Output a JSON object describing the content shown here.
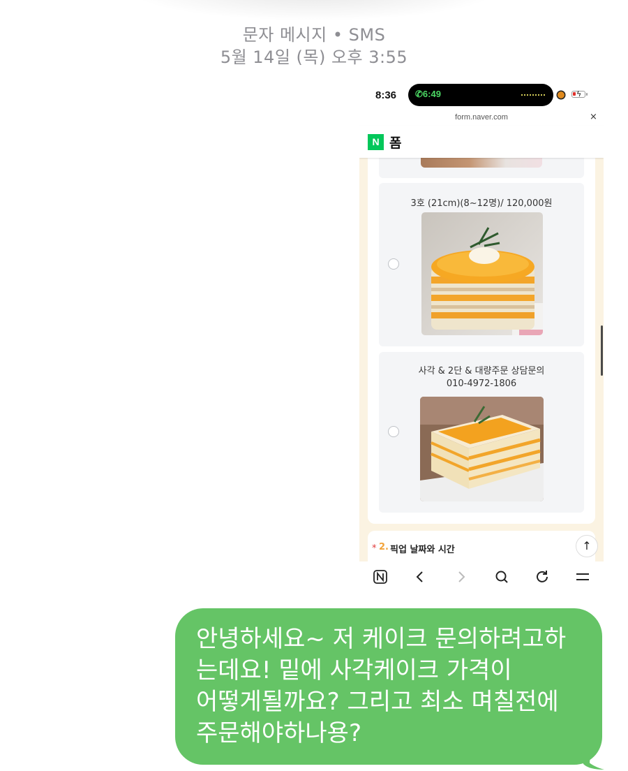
{
  "header": {
    "type_label": "문자 메시지 • SMS",
    "timestamp": "5월 14일 (목) 오후 3:55"
  },
  "screenshot": {
    "status_bar": {
      "time": "8:36",
      "call_timer": "6:49"
    },
    "browser": {
      "url": "form.naver.com",
      "close_label": "×",
      "app_logo": "N",
      "title": "폼"
    },
    "options": [
      {
        "label": "3호 (21cm)(8~12명)/ 120,000원",
        "image_desc": "round mango layer cake"
      },
      {
        "label_line1": "사각 & 2단 & 대량주문 상담문의",
        "label_line2": "010-4972-1806",
        "image_desc": "square mango layer cake"
      }
    ],
    "next_question": {
      "required_mark": "*",
      "number": "2.",
      "text": "픽업 날짜와 시간"
    },
    "toolbar_icons": [
      "naver-home-icon",
      "back-icon",
      "forward-icon",
      "search-icon",
      "refresh-icon",
      "menu-icon"
    ]
  },
  "message": {
    "line1": "안녕하세요~ 저 케이크 문의하려고하",
    "line2": "는데요! 밑에 사각케이크 가격이",
    "line3": "어떻게될까요? 그리고 최소 며칠전에",
    "line4": "주문해야하나용?"
  },
  "colors": {
    "bubble": "#65c466",
    "naver_green": "#03c75a",
    "form_bg": "#fbf3e2",
    "required": "#e03a3a",
    "question_number": "#f2a33a"
  }
}
